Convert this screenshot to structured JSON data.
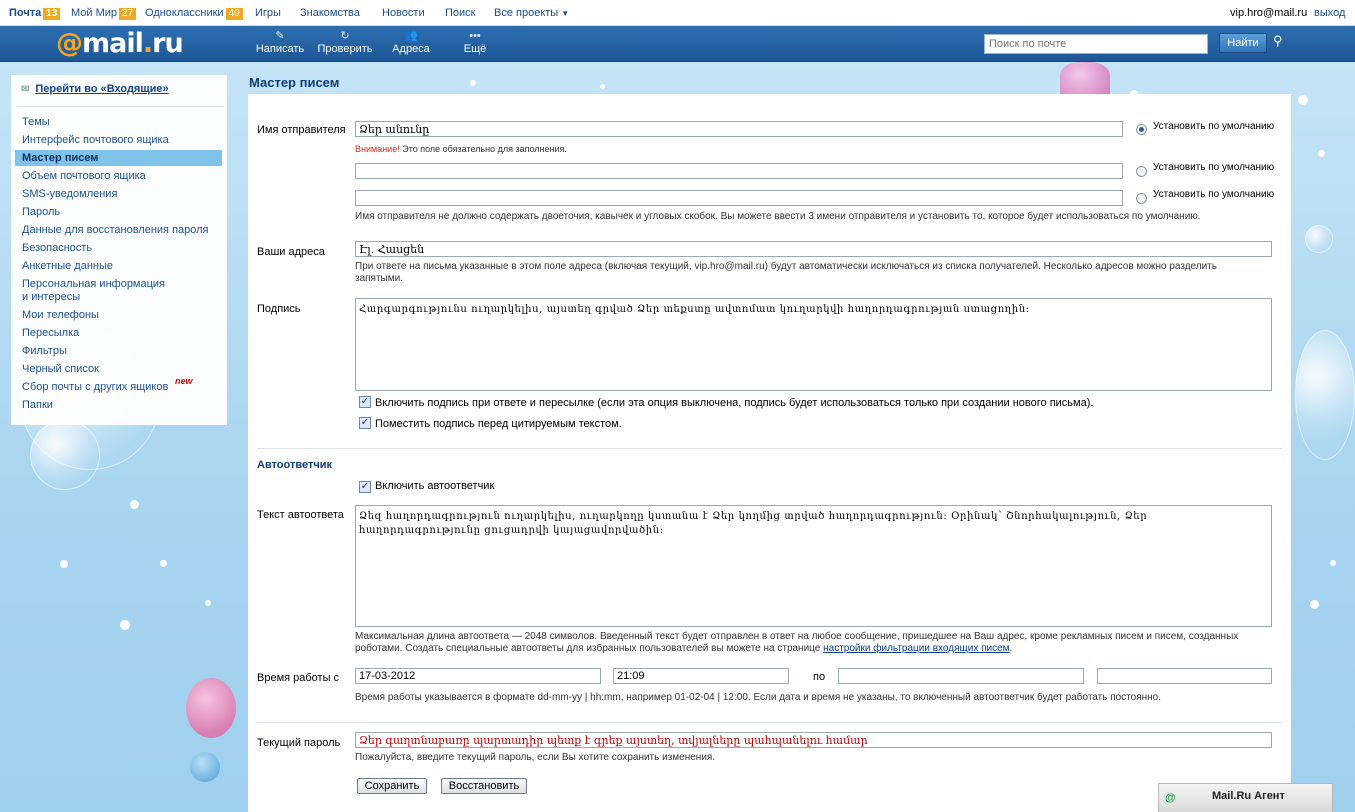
{
  "topbar": {
    "mail": {
      "label": "Почта",
      "count": "13"
    },
    "myworld": {
      "label": "Мой Мир",
      "count": "27"
    },
    "ok": {
      "label": "Одноклассники",
      "count": "40"
    },
    "games": "Игры",
    "dating": "Знакомства",
    "news": "Новости",
    "search": "Поиск",
    "allprojects": "Все проекты",
    "user": "vip.hro@mail.ru",
    "logout": "выход"
  },
  "header": {
    "logo_at": "@",
    "logo_mail": "mail",
    "logo_dot": ".",
    "logo_ru": "ru",
    "compose": "Написать",
    "check": "Проверить",
    "addresses": "Адреса",
    "more": "Ещё",
    "search_placeholder": "Поиск по почте",
    "find_button": "Найти"
  },
  "sidebar": {
    "inbox_link": "Перейти во «Входящие»",
    "items": [
      "Темы",
      "Интерфейс почтового ящика",
      "Мастер писем",
      "Объем почтового ящика",
      "SMS-уведомления",
      "Пароль",
      "Данные для восстановления пароля",
      "Безопасность",
      "Анкетные данные",
      "Персональная информация",
      "и интересы",
      "Мои телефоны",
      "Пересылка",
      "Фильтры",
      "Черный список",
      "Сбор почты с других ящиков",
      "Папки"
    ],
    "new_badge": "new"
  },
  "page": {
    "title": "Мастер писем",
    "sender": {
      "label": "Имя отправителя",
      "value1": "Ձեր անունը",
      "value2": "",
      "value3": "",
      "default_label": "Установить по умолчанию",
      "warning_strong": "Внимание!",
      "warning_text": "Это поле обязательно для заполнения.",
      "hint": "Имя отправителя не должно содержать двоеточия, кавычек и угловых скобок. Вы можете ввести 3 имени отправителя и установить то, которое будет использоваться по умолчанию."
    },
    "addresses": {
      "label": "Ваши адреса",
      "value": "Էլ. Հասցեն",
      "hint1": "При ответе на письма указанные в этом поле адреса (включая текущий, vip.hro@mail.ru) будут автоматически исключаться из списка получателей. Несколько адресов можно разделить",
      "hint2": "запятыми."
    },
    "signature": {
      "label": "Подпись",
      "value": "Հարգարգությունս ուղարկելիս, այստեղ գրված Ձեր տեքստը ավտոմատ կուղարկվի հաղորդագրության ստացողին:",
      "check1": "Включить подпись при ответе и пересылке (если эта опция выключена, подпись будет использоваться только при создании нового письма).",
      "check2": "Поместить подпись перед цитируемым текстом."
    },
    "autoresponder": {
      "heading": "Автоответчик",
      "enable": "Включить автоответчик",
      "label": "Текст автоответа",
      "value": "Ձեզ հաղորդագրություն ուղարկելիս, ուղարկողը կստանա է Ձեր կողմից տրված հաղորդագրություն: Օրինակ՝ Շնորհակալություն, Ձեր հաղորդագրությունը ցուցադրվի կայացավորվածին:",
      "hint1": "Максимальная длина автоответа — 2048 символов. Введенный текст будет отправлен в ответ на любое сообщение, пришедшее на Ваш адрес, кроме рекламных писем и писем, созданных",
      "hint2": "роботами. Создать специальные автоответы для избранных пользователей вы можете на странице",
      "hint_link": "настройки фильтрации входящих писем",
      "hint_end": "."
    },
    "worktime": {
      "label": "Время работы с",
      "date_from": "17-03-2012",
      "time_from": "21:09",
      "to": "по",
      "date_to": "",
      "time_to": "",
      "hint": "Время работы указывается в формате dd-mm-yy | hh:mm, например 01-02-04 | 12:00. Если дата и время не указаны, то включенный автоответчик будет работать постоянно."
    },
    "password": {
      "label": "Текущий пароль",
      "value": "Ձեր գաղտնաբառը պարտադիր պետք է գրեք այստեղ, տվյալները պահպանելու համար",
      "hint": "Пожалуйста, введите текущий пароль, если Вы хотите сохранить изменения."
    },
    "save_button": "Сохранить",
    "restore_button": "Восстановить"
  },
  "agent": {
    "label": "Mail.Ru Агент",
    "icon": "@"
  },
  "colors": {
    "header": "#2569a8",
    "accent": "#f0a922",
    "warning": "#d0301a",
    "armenian_red": "#c00000"
  }
}
